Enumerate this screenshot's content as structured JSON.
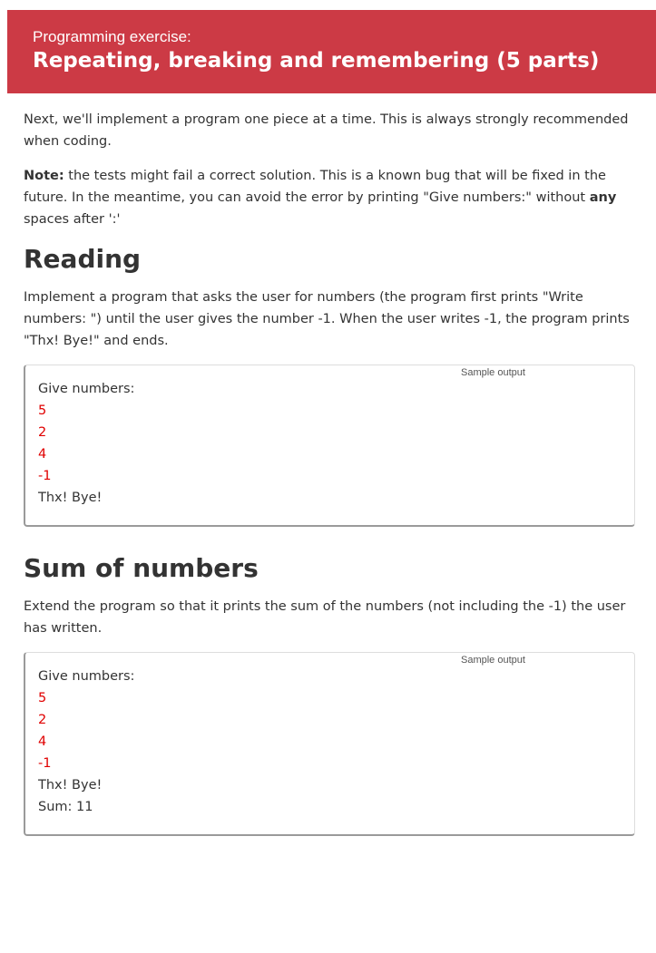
{
  "banner": {
    "label": "Programming exercise:",
    "title": "Repeating, breaking and remembering (5 parts)"
  },
  "intro": {
    "text": "Next, we'll implement a program one piece at a time. This is always strongly recommended when coding."
  },
  "note": {
    "bold_label": "Note:",
    "text_before": " the tests might fail a correct solution. This is a known bug that will be fixed in the future. In the meantime, you can avoid the error by printing \"Give numbers:\" without ",
    "bold_word": "any",
    "text_after": " spaces after ':'"
  },
  "sections": [
    {
      "heading": "Reading",
      "description": "Implement a program that asks the user for numbers (the program first prints \"Write numbers: \") until the user gives the number -1. When the user writes -1, the program prints \"Thx! Bye!\" and ends.",
      "sample_label": "Sample output",
      "lines": [
        {
          "text": "Give numbers:",
          "kind": "output"
        },
        {
          "text": "5",
          "kind": "input"
        },
        {
          "text": "2",
          "kind": "input"
        },
        {
          "text": "4",
          "kind": "input"
        },
        {
          "text": "-1",
          "kind": "input"
        },
        {
          "text": "Thx! Bye!",
          "kind": "output"
        }
      ]
    },
    {
      "heading": "Sum of numbers",
      "description": "Extend the program so that it prints the sum of the numbers (not including the -1) the user has written.",
      "sample_label": "Sample output",
      "lines": [
        {
          "text": "Give numbers:",
          "kind": "output"
        },
        {
          "text": "5",
          "kind": "input"
        },
        {
          "text": "2",
          "kind": "input"
        },
        {
          "text": "4",
          "kind": "input"
        },
        {
          "text": "-1",
          "kind": "input"
        },
        {
          "text": "Thx! Bye!",
          "kind": "output"
        },
        {
          "text": "Sum: 11",
          "kind": "output"
        }
      ]
    }
  ],
  "colors": {
    "banner_background": "#cc3a45",
    "user_input_text": "#e00000",
    "body_text": "#333333"
  }
}
